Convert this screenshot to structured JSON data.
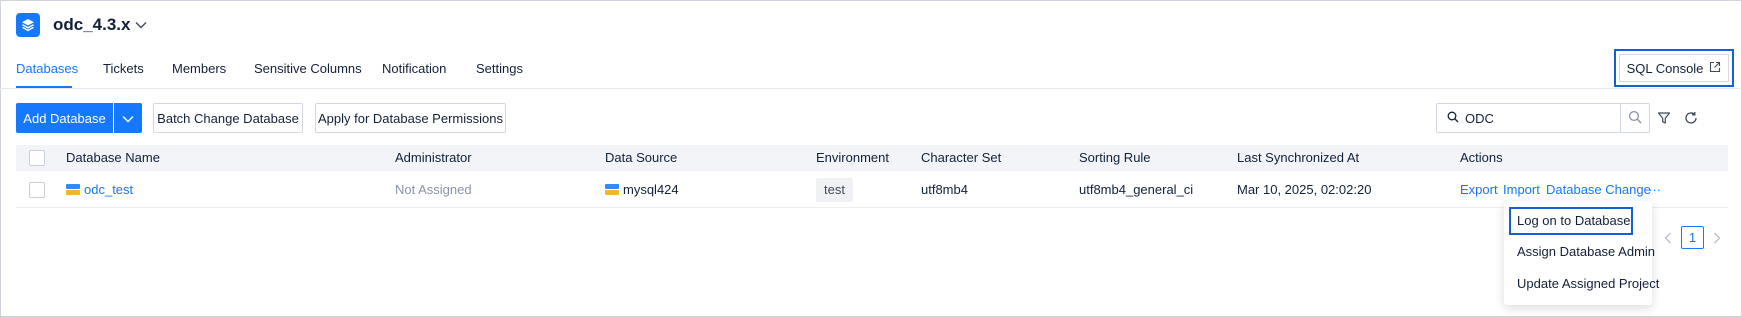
{
  "header": {
    "project_name": "odc_4.3.x",
    "project_icon": "layers-icon"
  },
  "tabs": [
    {
      "label": "Databases",
      "active": true
    },
    {
      "label": "Tickets"
    },
    {
      "label": "Members"
    },
    {
      "label": "Sensitive Columns"
    },
    {
      "label": "Notification"
    },
    {
      "label": "Settings"
    }
  ],
  "sql_console": {
    "label": "SQL Console",
    "icon": "external-link-icon"
  },
  "toolbar": {
    "add_database": "Add Database",
    "batch_change": "Batch Change Database",
    "apply_permissions": "Apply for Database Permissions",
    "search_value": "ODC"
  },
  "table": {
    "columns": [
      "Database Name",
      "Administrator",
      "Data Source",
      "Environment",
      "Character Set",
      "Sorting Rule",
      "Last Synchronized At",
      "Actions"
    ],
    "rows": [
      {
        "database_name": "odc_test",
        "administrator": "Not Assigned",
        "data_source": "mysql424",
        "environment": "test",
        "character_set": "utf8mb4",
        "sorting_rule": "utf8mb4_general_ci",
        "last_synced": "Mar 10, 2025, 02:02:20",
        "actions": [
          "Export",
          "Import",
          "Database Change"
        ],
        "more": "···"
      }
    ]
  },
  "dropdown": {
    "items": [
      "Log on to Database",
      "Assign Database Admin",
      "Update Assigned Project"
    ]
  },
  "pagination": {
    "current_page": "1"
  },
  "colors": {
    "primary": "#1677ff",
    "highlight": "#1260d6"
  }
}
